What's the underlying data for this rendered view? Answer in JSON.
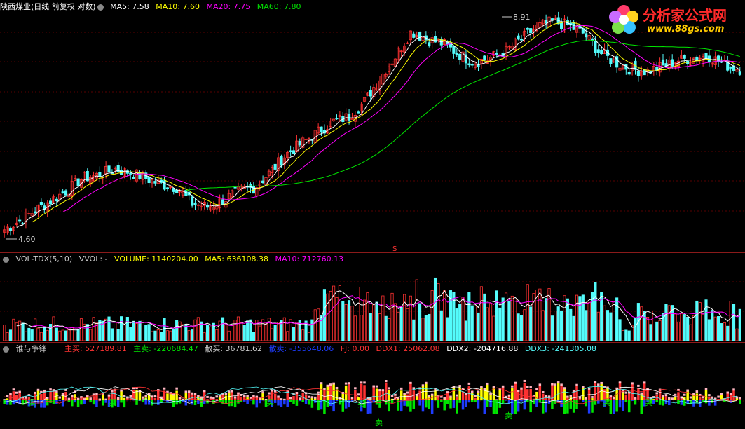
{
  "main_header": {
    "title": "陕西煤业(日线 前复权 对数)",
    "ma5": "MA5: 7.58",
    "ma10": "MA10: 7.60",
    "ma20": "MA20: 7.75",
    "ma60": "MA60: 7.80"
  },
  "price_labels": {
    "high": "8.91",
    "low": "4.60",
    "marker": "S"
  },
  "logo": {
    "text": "分析家公式网",
    "url": "www.88gs.com"
  },
  "vol_header": {
    "title": "VOL-TDX(5,10)",
    "vvol": "VVOL: -",
    "volume": "VOLUME: 1140204.00",
    "ma5": "MA5: 636108.38",
    "ma10": "MA10: 712760.13"
  },
  "ind_header": {
    "title": "谁与争锋",
    "zhumai": "主买: 527189.81",
    "zhumai2": "主卖: -220684.47",
    "sanmai": "散买: 36781.62",
    "sanmai2": "散卖: -355648.06",
    "fj": "FJ: 0.00",
    "ddx1": "DDX1: 25062.08",
    "ddx2": "DDX2: -204716.88",
    "ddx3": "DDX3: -241305.08"
  },
  "signals": {
    "buy": "买",
    "sell": "卖"
  },
  "colors": {
    "up": "#ff3232",
    "down": "#54fcfc",
    "ma5": "#ffffff",
    "ma10": "#ffff00",
    "ma20": "#ff00ff",
    "ma60": "#00e600",
    "grid": "#5a0000",
    "sep": "#8b1a1a"
  },
  "chart_data": {
    "type": "candlestick",
    "scale": "log",
    "ylim": [
      4.6,
      8.91
    ],
    "key_points": [
      {
        "label": "low",
        "value": 4.6
      },
      {
        "label": "high",
        "value": 8.91
      }
    ],
    "last_values": {
      "ma5": 7.58,
      "ma10": 7.6,
      "ma20": 7.75,
      "ma60": 7.8,
      "volume": 1140204.0,
      "vol_ma5": 636108.38,
      "vol_ma10": 712760.13,
      "main_buy": 527189.81,
      "main_sell": -220684.47,
      "retail_buy": 36781.62,
      "retail_sell": -355648.06,
      "fj": 0.0,
      "ddx1": 25062.08,
      "ddx2": -204716.88,
      "ddx3": -241305.08
    },
    "trend": [
      4.72,
      4.85,
      5.0,
      5.15,
      5.3,
      5.5,
      5.55,
      5.65,
      5.6,
      5.5,
      5.4,
      5.35,
      5.1,
      5.05,
      5.15,
      5.3,
      5.35,
      5.6,
      5.9,
      6.1,
      6.3,
      6.5,
      6.6,
      6.9,
      7.4,
      7.9,
      8.5,
      8.3,
      8.2,
      7.95,
      7.75,
      7.85,
      8.0,
      8.3,
      8.6,
      8.75,
      8.65,
      8.45,
      8.0,
      7.75,
      7.6,
      7.55,
      7.65,
      7.8,
      7.85,
      7.9,
      7.7,
      7.6
    ]
  }
}
